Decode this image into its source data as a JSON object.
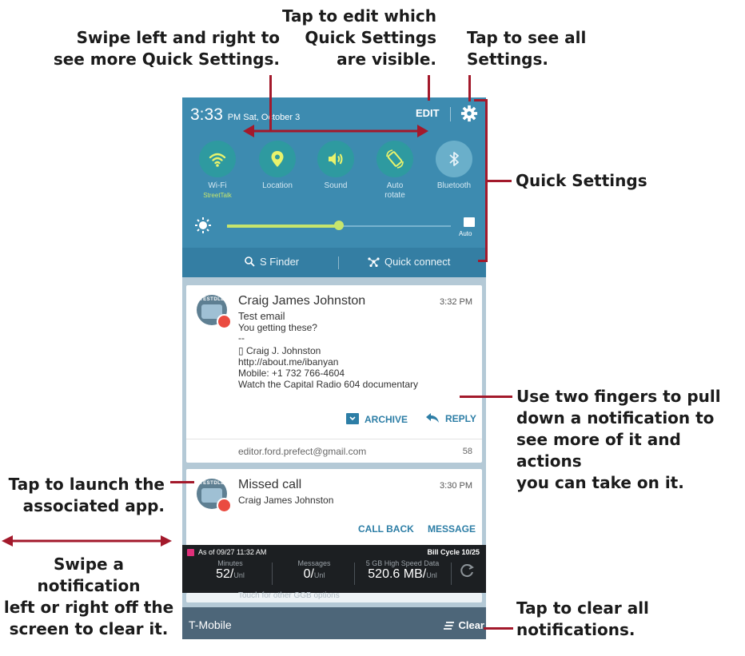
{
  "callouts": {
    "swipe_qs": "Swipe left and right to\nsee more Quick Settings.",
    "edit_qs": "Tap to edit which\nQuick Settings\nare visible.",
    "all_settings": "Tap to see all\nSettings.",
    "quick_settings": "Quick Settings",
    "two_fingers": "Use two fingers to pull\ndown a notification to\nsee more of it and actions\nyou can take on it.",
    "launch_app": "Tap to launch the\nassociated app.",
    "swipe_clear": "Swipe a notification\nleft or right off the\nscreen to clear it.",
    "clear_all": "Tap to clear all\nnotifications."
  },
  "status": {
    "time": "3:33",
    "ampm_date": "PM Sat, October 3",
    "edit": "EDIT",
    "settings_icon": "gear-icon"
  },
  "quick_settings": [
    {
      "label": "Wi-Fi",
      "sub": "StreetTalk",
      "icon": "wifi-icon",
      "on": true
    },
    {
      "label": "Location",
      "sub": "",
      "icon": "location-icon",
      "on": true
    },
    {
      "label": "Sound",
      "sub": "",
      "icon": "sound-icon",
      "on": true
    },
    {
      "label": "Auto\nrotate",
      "sub": "",
      "icon": "auto-rotate-icon",
      "on": true
    },
    {
      "label": "Bluetooth",
      "sub": "",
      "icon": "bluetooth-icon",
      "on": false
    }
  ],
  "brightness": {
    "level": 0.5,
    "auto_label": "Auto"
  },
  "tools": {
    "finder": "S Finder",
    "quick_connect": "Quick connect"
  },
  "notifications": {
    "email": {
      "sender": "Craig James Johnston",
      "time": "3:32 PM",
      "subject": "Test email",
      "lines": [
        "You getting these?",
        "--",
        "▯ Craig J. Johnston",
        "http://about.me/ibanyan",
        "Mobile: +1 732 766-4604",
        "Watch the Capital Radio 604 documentary"
      ],
      "archive": "ARCHIVE",
      "reply": "REPLY",
      "account": "editor.ford.prefect@gmail.com",
      "count": "58",
      "avatar_text": "TESTDLL"
    },
    "missed": {
      "title": "Missed call",
      "time": "3:30 PM",
      "caller": "Craig James Johnston",
      "call_back": "CALL BACK",
      "message": "MESSAGE"
    }
  },
  "carrier_widget": {
    "as_of": "As of 09/27 11:32 AM",
    "bill_cycle": "Bill Cycle 10/25",
    "minutes_label": "Minutes",
    "minutes_value": "52/",
    "minutes_unit": "Unl",
    "messages_label": "Messages",
    "messages_value": "0/",
    "messages_unit": "Unl",
    "data_label": "5 GB High Speed Data",
    "data_value": "520.6 MB/",
    "data_unit": "Unl"
  },
  "bottom": {
    "carrier": "T-Mobile",
    "clear": "Clear",
    "hidden_text": "Touch for other GGB options"
  },
  "colors": {
    "callout_line": "#a3192b",
    "shade": "#3d8bb0",
    "accent": "#2d7ea6"
  }
}
